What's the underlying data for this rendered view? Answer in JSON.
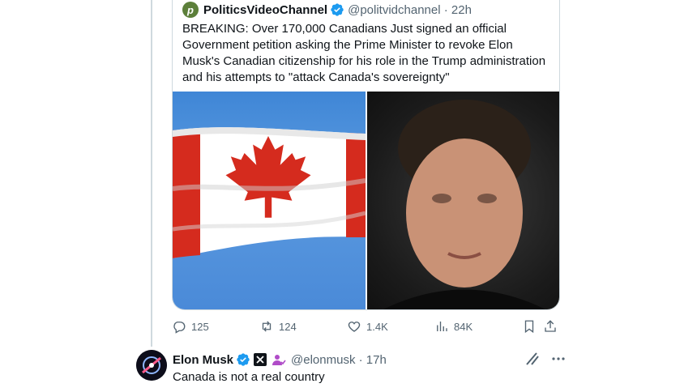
{
  "quoted_post": {
    "avatar_letter": "p",
    "name": "PoliticsVideoChannel",
    "handle": "@politvidchannel",
    "time": "22h",
    "text": "BREAKING: Over 170,000 Canadians Just signed an official Government petition asking the Prime Minister to revoke Elon Musk's Canadian citizenship for his role in the Trump administration and his attempts to \"attack Canada's sovereignty\"",
    "media": [
      "canadian-flag-photo",
      "elon-musk-photo"
    ]
  },
  "actions": {
    "replies": "125",
    "reposts": "124",
    "likes": "1.4K",
    "views": "84K"
  },
  "reply": {
    "name": "Elon Musk",
    "handle": "@elonmusk",
    "time": "17h",
    "text": "Canada is not a real country"
  },
  "colors": {
    "verified": "#1d9bf0",
    "muted": "#536471",
    "border": "#cfd9de",
    "canada_red": "#d52b1e"
  }
}
